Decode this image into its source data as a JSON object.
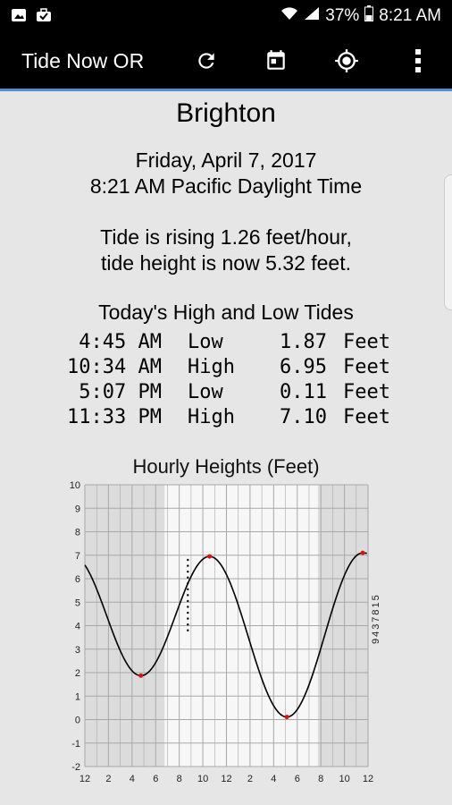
{
  "status": {
    "battery_pct": "37%",
    "time": "8:21 AM"
  },
  "toolbar": {
    "title": "Tide Now OR"
  },
  "location": "Brighton",
  "date_line": "Friday, April 7, 2017",
  "time_line": "8:21 AM Pacific Daylight Time",
  "tide_rate_line": "Tide is rising  1.26 feet/hour,",
  "tide_height_line": "tide height is now  5.32 feet.",
  "hilo_heading": "Today's High and Low Tides",
  "tides": [
    {
      "time": "4:45 AM",
      "type": "Low",
      "height": "1.87",
      "unit": "Feet"
    },
    {
      "time": "10:34 AM",
      "type": "High",
      "height": "6.95",
      "unit": "Feet"
    },
    {
      "time": "5:07 PM",
      "type": "Low",
      "height": "0.11",
      "unit": "Feet"
    },
    {
      "time": "11:33 PM",
      "type": "High",
      "height": "7.10",
      "unit": "Feet"
    }
  ],
  "chart_data": {
    "type": "line",
    "title": "Hourly Heights (Feet)",
    "station_id": "9437815",
    "x_tick_labels": [
      "12",
      "2",
      "4",
      "6",
      "8",
      "10",
      "12",
      "2",
      "4",
      "6",
      "8",
      "10",
      "12"
    ],
    "y_tick_labels": [
      "10",
      "9",
      "8",
      "7",
      "6",
      "5",
      "4",
      "3",
      "2",
      "1",
      "0",
      "-1",
      "-2"
    ],
    "xlim": [
      0,
      24
    ],
    "ylim": [
      -2,
      10
    ],
    "daylight_hours": [
      6.75,
      19.75
    ],
    "current_hour": 8.35,
    "extremes": [
      {
        "hour": 4.75,
        "height": 1.87
      },
      {
        "hour": 10.57,
        "height": 6.95
      },
      {
        "hour": 17.12,
        "height": 0.11
      },
      {
        "hour": 23.55,
        "height": 7.1
      }
    ],
    "start_height": 6.3,
    "grid": true
  }
}
